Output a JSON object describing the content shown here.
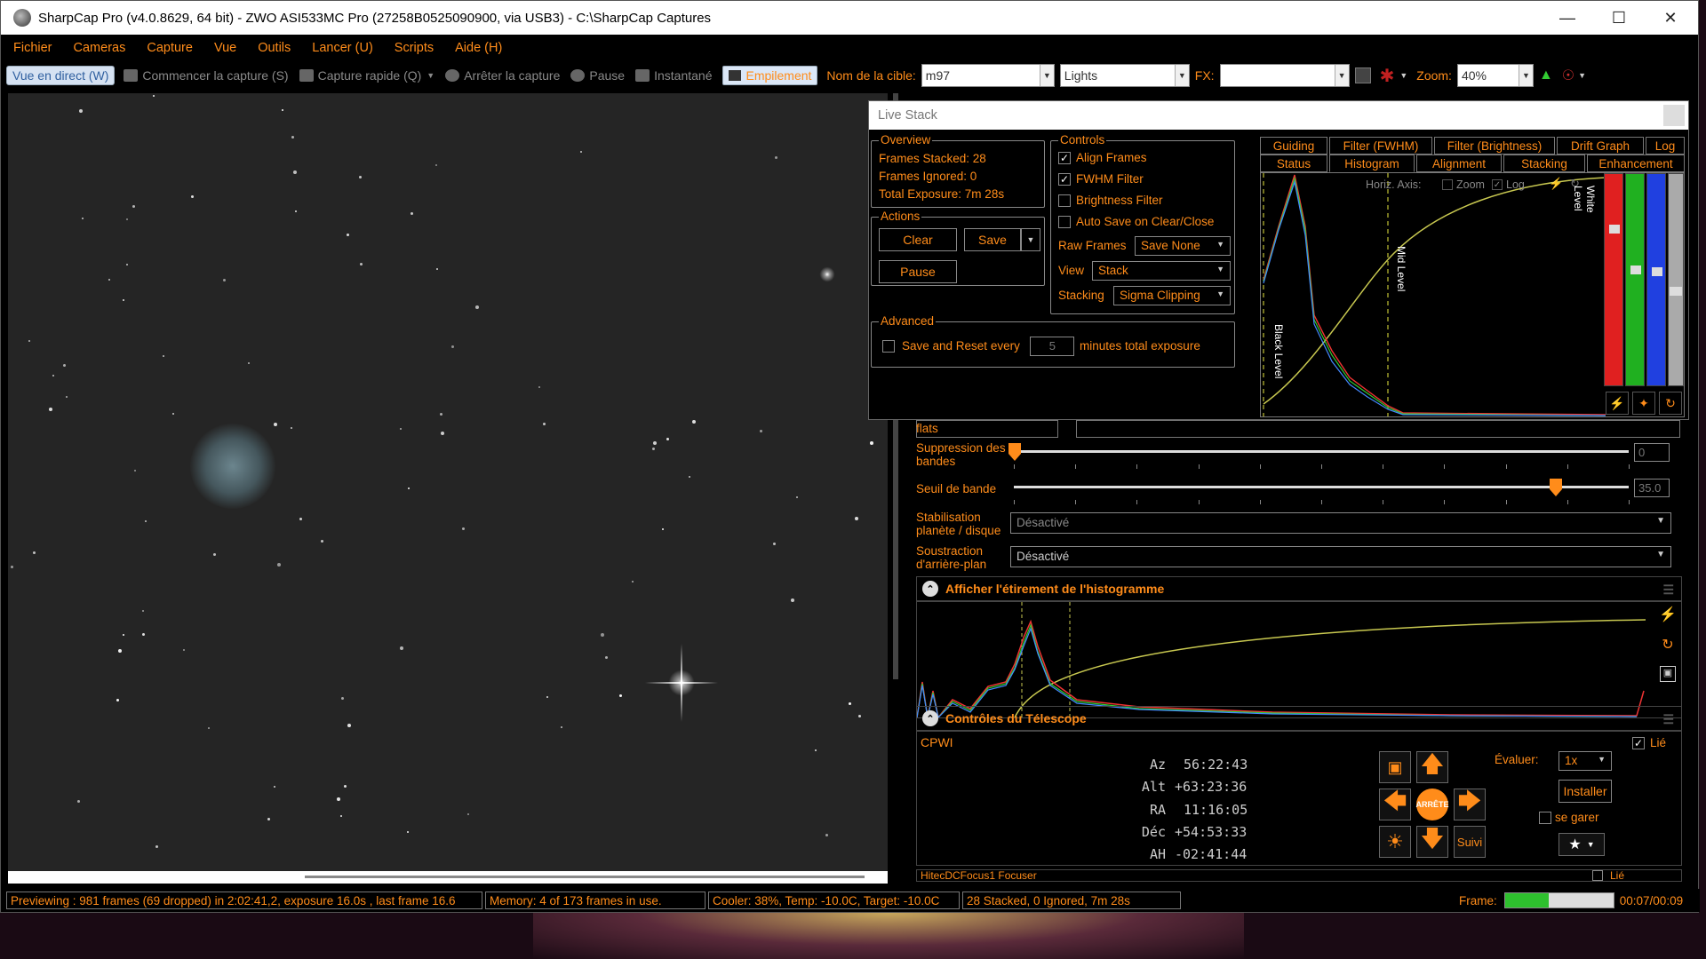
{
  "window": {
    "title": "SharpCap Pro (v4.0.8629, 64 bit) - ZWO ASI533MC Pro (27258B0525090900, via USB3) - C:\\SharpCap Captures"
  },
  "menu": [
    "Fichier",
    "Cameras",
    "Capture",
    "Vue",
    "Outils",
    "Lancer (U)",
    "Scripts",
    "Aide (H)"
  ],
  "toolbar": {
    "live_view": "Vue en direct (W)",
    "start_capture": "Commencer la capture (S)",
    "quick_capture": "Capture rapide (Q)",
    "stop_capture": "Arrêter la capture",
    "pause": "Pause",
    "snapshot": "Instantané",
    "stacking": "Empilement",
    "target_label": "Nom de la cible:",
    "target_value": "m97",
    "frame_type": "Lights",
    "fx_label": "FX:",
    "fx_value": "",
    "zoom_label": "Zoom:",
    "zoom_value": "40%"
  },
  "status_bar": {
    "previewing": "Previewing : 981 frames (69 dropped) in 2:02:41,2, exposure 16.0s , last frame 16.6",
    "memory": "Memory: 4 of 173 frames in use.",
    "cooler": "Cooler: 38%, Temp: -10.0C, Target: -10.0C",
    "stack": "28 Stacked, 0 Ignored, 7m 28s",
    "frame_label": "Frame:",
    "frame_progress": 0.4,
    "frame_time": "00:07/00:09"
  },
  "live_stack": {
    "title": "Live Stack",
    "overview": {
      "title": "Overview",
      "frames_stacked": "Frames Stacked:  28",
      "frames_ignored": "Frames Ignored:  0",
      "total_exposure": "Total Exposure:    7m 28s"
    },
    "actions": {
      "title": "Actions",
      "clear": "Clear",
      "save": "Save",
      "pause": "Pause"
    },
    "controls": {
      "title": "Controls",
      "align_frames": "Align Frames",
      "fwhm_filter": "FWHM Filter",
      "brightness_filter": "Brightness Filter",
      "auto_save": "Auto Save on Clear/Close",
      "raw_frames_label": "Raw Frames",
      "raw_frames_value": "Save None",
      "view_label": "View",
      "view_value": "Stack",
      "stacking_label": "Stacking",
      "stacking_value": "Sigma Clipping"
    },
    "advanced": {
      "title": "Advanced",
      "save_reset": "Save and Reset every",
      "minutes_value": "5",
      "minutes_suffix": "minutes total exposure"
    },
    "tabs_row1": [
      "Guiding",
      "Filter (FWHM)",
      "Filter (Brightness)",
      "Drift Graph",
      "Log"
    ],
    "tabs_row2": [
      "Status",
      "Histogram",
      "Alignment",
      "Stacking",
      "Enhancement"
    ],
    "histogram": {
      "horiz_axis": "Horiz. Axis:",
      "zoom": "Zoom",
      "log": "Log",
      "black_level": "Black Level",
      "mid_level": "Mid Level",
      "white_level": "White Level"
    }
  },
  "camera_panel": {
    "flats_label": "flats",
    "banding_label": "Suppression des bandes",
    "banding_value": "0",
    "threshold_label": "Seuil de bande",
    "threshold_value": "35.0",
    "stab_label": "Stabilisation planète / disque",
    "stab_value": "Désactivé",
    "bg_label": "Soustraction d'arrière-plan",
    "bg_value": "Désactivé",
    "histo_section": "Afficher l'étirement de l'histogramme",
    "tele_section": "Contrôles du Télescope",
    "tele_name": "CPWI",
    "linked": "Lié",
    "az_label": "Az",
    "az": "56:22:43",
    "alt_label": "Alt",
    "alt": "+63:23:36",
    "ra_label": "RA",
    "ra": "11:16:05",
    "dec_label": "Déc",
    "dec": "+54:53:33",
    "ah_label": "AH",
    "ah": "-02:41:44",
    "rate_label": "Évaluer:",
    "rate_value": "1x",
    "install": "Installer",
    "park": "se garer",
    "stop": "ARRÊTE",
    "track": "Suivi",
    "focuser": "HitecDCFocus1 Focuser",
    "focuser_linked": "Lié"
  },
  "colors": {
    "accent": "#ff8c1a"
  }
}
